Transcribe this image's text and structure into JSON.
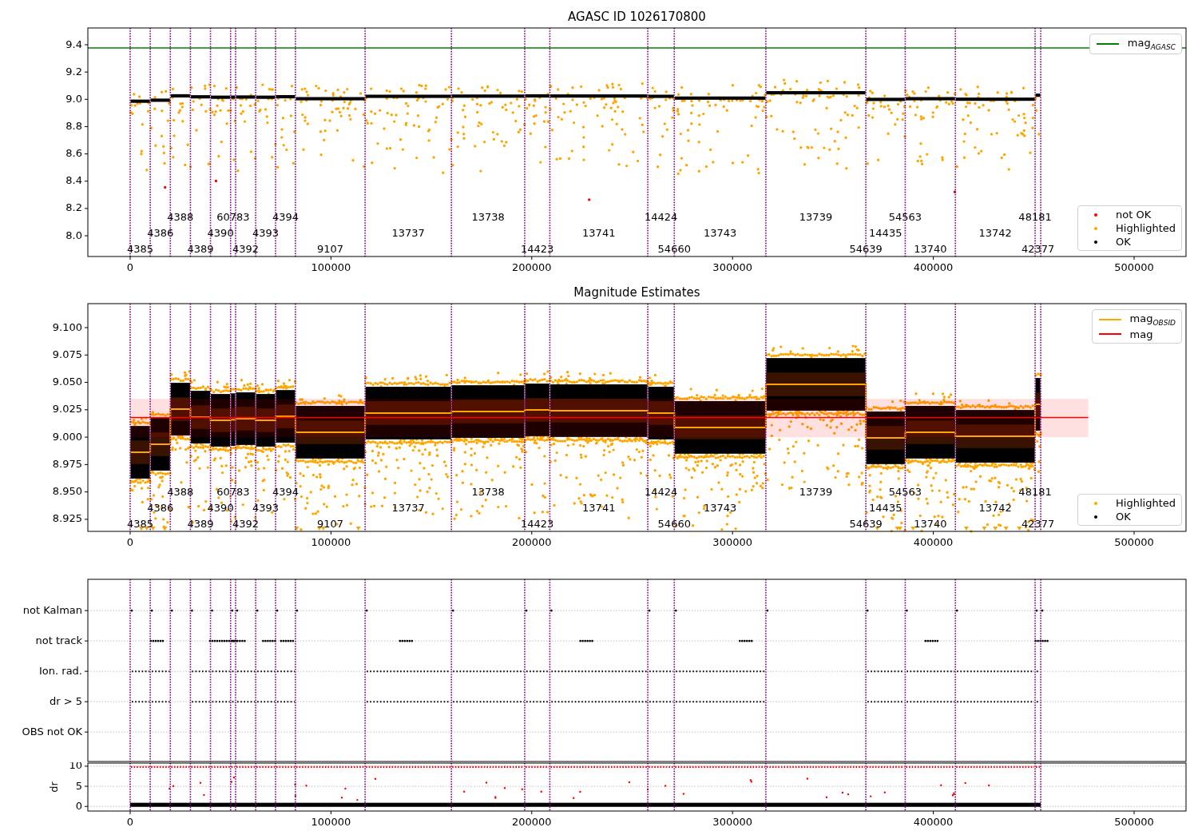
{
  "panels": [
    {
      "kind": "magnitude",
      "chart_data": {
        "type": "scatter",
        "title": "AGASC ID 1026170800",
        "xlim": [
          -21080,
          525860
        ],
        "ylim": [
          7.848,
          9.523
        ],
        "xticks": [
          0,
          100000,
          200000,
          300000,
          400000,
          500000
        ],
        "yticks": [
          {
            "value": 8.0,
            "label": "8.0"
          },
          {
            "value": 8.2,
            "label": "8.2"
          },
          {
            "value": 8.4,
            "label": "8.4"
          },
          {
            "value": 8.6,
            "label": "8.6"
          },
          {
            "value": 8.8,
            "label": "8.8"
          },
          {
            "value": 9.0,
            "label": "9.0"
          },
          {
            "value": 9.2,
            "label": "9.2"
          },
          {
            "value": 9.4,
            "label": "9.4"
          }
        ],
        "ref_lines": [
          {
            "axis": "y",
            "value": 9.377,
            "color": "#008000"
          },
          {
            "axis": "x",
            "value": 0,
            "color": "#800080"
          },
          {
            "axis": "x",
            "value": 10000,
            "color": "#800080"
          },
          {
            "axis": "x",
            "value": 20000,
            "color": "#800080"
          },
          {
            "axis": "x",
            "value": 30000,
            "color": "#800080"
          },
          {
            "axis": "x",
            "value": 40000,
            "color": "#800080"
          },
          {
            "axis": "x",
            "value": 50000,
            "color": "#800080"
          },
          {
            "axis": "x",
            "value": 52500,
            "color": "#800080"
          },
          {
            "axis": "x",
            "value": 62500,
            "color": "#800080"
          },
          {
            "axis": "x",
            "value": 72400,
            "color": "#800080"
          },
          {
            "axis": "x",
            "value": 82300,
            "color": "#800080"
          },
          {
            "axis": "x",
            "value": 117000,
            "color": "#800080"
          },
          {
            "axis": "x",
            "value": 160000,
            "color": "#800080"
          },
          {
            "axis": "x",
            "value": 196500,
            "color": "#800080"
          },
          {
            "axis": "x",
            "value": 209000,
            "color": "#800080"
          },
          {
            "axis": "x",
            "value": 257800,
            "color": "#800080"
          },
          {
            "axis": "x",
            "value": 271000,
            "color": "#800080"
          },
          {
            "axis": "x",
            "value": 316600,
            "color": "#800080"
          },
          {
            "axis": "x",
            "value": 366400,
            "color": "#800080"
          },
          {
            "axis": "x",
            "value": 386000,
            "color": "#800080"
          },
          {
            "axis": "x",
            "value": 411000,
            "color": "#800080"
          },
          {
            "axis": "x",
            "value": 450700,
            "color": "#800080"
          },
          {
            "axis": "x",
            "value": 453500,
            "color": "#800080"
          }
        ],
        "annotations": [
          "4385",
          "4386",
          "4388",
          "4389",
          "4390",
          "60783",
          "4392",
          "4393",
          "4394",
          "9107",
          "13737",
          "13738",
          "14423",
          "13741",
          "14424",
          "54660",
          "13743",
          "13739",
          "54639",
          "14435",
          "54563",
          "13740",
          "13742",
          "48181",
          "42377"
        ]
      },
      "legends": [
        {
          "entries": [
            {
              "kind": "line",
              "label": "mag$_{AGASC}$",
              "color": "#008000"
            }
          ]
        },
        {
          "entries": [
            {
              "kind": "dot",
              "label": "not OK",
              "color": "#ff0000"
            },
            {
              "kind": "dot",
              "label": "Highlighted",
              "color": "#ffa500"
            },
            {
              "kind": "dot",
              "label": "OK",
              "color": "#000000"
            }
          ]
        }
      ]
    },
    {
      "kind": "estimates",
      "chart_data": {
        "type": "line",
        "title": "Magnitude Estimates",
        "xlim": [
          -21080,
          525860
        ],
        "ylim": [
          8.914,
          9.1219
        ],
        "xticks": [
          0,
          100000,
          200000,
          300000,
          400000,
          500000
        ],
        "yticks": [
          {
            "value": 8.925,
            "label": "8.925"
          },
          {
            "value": 8.95,
            "label": "8.950"
          },
          {
            "value": 8.975,
            "label": "8.975"
          },
          {
            "value": 9.0,
            "label": "9.000"
          },
          {
            "value": 9.025,
            "label": "9.025"
          },
          {
            "value": 9.05,
            "label": "9.050"
          },
          {
            "value": 9.075,
            "label": "9.075"
          },
          {
            "value": 9.1,
            "label": "9.100"
          }
        ],
        "x": [
          0,
          10000,
          10000,
          20000,
          20000,
          30000,
          30000,
          40000,
          40000,
          50000,
          50000,
          52500,
          52500,
          62500,
          62500,
          72400,
          72400,
          82300,
          82300,
          117000,
          117000,
          160000,
          160000,
          196500,
          196500,
          209000,
          209000,
          257800,
          257800,
          271000,
          271000,
          316600,
          316600,
          366400,
          366400,
          386000,
          386000,
          411000,
          411000,
          450700,
          450700,
          453500
        ],
        "series": [
          {
            "name": "mag$_{OBSID}$",
            "color": "#ffa500",
            "values": [
              8.9862,
              8.9862,
              8.9935,
              8.9935,
              9.0256,
              9.0256,
              9.0183,
              9.0183,
              9.0154,
              9.0154,
              9.016,
              9.016,
              9.0169,
              9.0169,
              9.0154,
              9.0154,
              9.019,
              9.019,
              9.0045,
              9.0045,
              9.022,
              9.022,
              9.0234,
              9.0234,
              9.0249,
              9.0249,
              9.0242,
              9.0242,
              9.022,
              9.022,
              9.0089,
              9.0089,
              9.0482,
              9.0482,
              8.9994,
              8.9994,
              9.0045,
              9.0045,
              9.0008,
              9.0008,
              9.03,
              9.03
            ]
          }
        ],
        "ref_lines": [
          {
            "axis": "y",
            "value": 9.018,
            "color": "#ff0000"
          },
          {
            "axis": "x",
            "value": 0,
            "color": "#800080"
          },
          {
            "axis": "x",
            "value": 10000,
            "color": "#800080"
          },
          {
            "axis": "x",
            "value": 20000,
            "color": "#800080"
          },
          {
            "axis": "x",
            "value": 30000,
            "color": "#800080"
          },
          {
            "axis": "x",
            "value": 40000,
            "color": "#800080"
          },
          {
            "axis": "x",
            "value": 50000,
            "color": "#800080"
          },
          {
            "axis": "x",
            "value": 52500,
            "color": "#800080"
          },
          {
            "axis": "x",
            "value": 62500,
            "color": "#800080"
          },
          {
            "axis": "x",
            "value": 72400,
            "color": "#800080"
          },
          {
            "axis": "x",
            "value": 82300,
            "color": "#800080"
          },
          {
            "axis": "x",
            "value": 117000,
            "color": "#800080"
          },
          {
            "axis": "x",
            "value": 160000,
            "color": "#800080"
          },
          {
            "axis": "x",
            "value": 196500,
            "color": "#800080"
          },
          {
            "axis": "x",
            "value": 209000,
            "color": "#800080"
          },
          {
            "axis": "x",
            "value": 257800,
            "color": "#800080"
          },
          {
            "axis": "x",
            "value": 271000,
            "color": "#800080"
          },
          {
            "axis": "x",
            "value": 316600,
            "color": "#800080"
          },
          {
            "axis": "x",
            "value": 366400,
            "color": "#800080"
          },
          {
            "axis": "x",
            "value": 386000,
            "color": "#800080"
          },
          {
            "axis": "x",
            "value": 411000,
            "color": "#800080"
          },
          {
            "axis": "x",
            "value": 450700,
            "color": "#800080"
          },
          {
            "axis": "x",
            "value": 453500,
            "color": "#800080"
          }
        ],
        "bands": [
          {
            "axis": "y",
            "from": 9.0,
            "to": 9.035,
            "color": "#ff0000"
          }
        ],
        "annotations": [
          "4385",
          "4386",
          "4388",
          "4389",
          "4390",
          "60783",
          "4392",
          "4393",
          "4394",
          "9107",
          "13737",
          "13738",
          "14423",
          "13741",
          "14424",
          "54660",
          "13743",
          "13739",
          "54639",
          "14435",
          "54563",
          "13740",
          "13742",
          "48181",
          "42377"
        ]
      },
      "legends": [
        {
          "entries": [
            {
              "kind": "line",
              "label": "mag",
              "color": "#ff0000"
            }
          ]
        },
        {
          "entries": [
            {
              "kind": "dot",
              "label": "Highlighted",
              "color": "#ffa500"
            },
            {
              "kind": "dot",
              "label": "OK",
              "color": "#000000"
            }
          ]
        }
      ]
    },
    {
      "kind": "flags",
      "chart_data": {
        "type": "scatter",
        "orientation": "horizontal",
        "xlim": [
          -21080,
          525860
        ],
        "grid": true,
        "categories": [
          "not Kalman",
          "not track",
          "Ion. rad.",
          "dr > 5",
          "OBS not OK"
        ],
        "ref_lines": [
          {
            "axis": "x",
            "value": 0,
            "color": "#800080"
          },
          {
            "axis": "x",
            "value": 10000,
            "color": "#800080"
          },
          {
            "axis": "x",
            "value": 20000,
            "color": "#800080"
          },
          {
            "axis": "x",
            "value": 30000,
            "color": "#800080"
          },
          {
            "axis": "x",
            "value": 40000,
            "color": "#800080"
          },
          {
            "axis": "x",
            "value": 50000,
            "color": "#800080"
          },
          {
            "axis": "x",
            "value": 52500,
            "color": "#800080"
          },
          {
            "axis": "x",
            "value": 62500,
            "color": "#800080"
          },
          {
            "axis": "x",
            "value": 72400,
            "color": "#800080"
          },
          {
            "axis": "x",
            "value": 82300,
            "color": "#800080"
          },
          {
            "axis": "x",
            "value": 117000,
            "color": "#800080"
          },
          {
            "axis": "x",
            "value": 160000,
            "color": "#800080"
          },
          {
            "axis": "x",
            "value": 196500,
            "color": "#800080"
          },
          {
            "axis": "x",
            "value": 209000,
            "color": "#800080"
          },
          {
            "axis": "x",
            "value": 257800,
            "color": "#800080"
          },
          {
            "axis": "x",
            "value": 271000,
            "color": "#800080"
          },
          {
            "axis": "x",
            "value": 316600,
            "color": "#800080"
          },
          {
            "axis": "x",
            "value": 366400,
            "color": "#800080"
          },
          {
            "axis": "x",
            "value": 386000,
            "color": "#800080"
          },
          {
            "axis": "x",
            "value": 411000,
            "color": "#800080"
          },
          {
            "axis": "x",
            "value": 450700,
            "color": "#800080"
          },
          {
            "axis": "x",
            "value": 453500,
            "color": "#800080"
          }
        ]
      }
    },
    {
      "kind": "dr",
      "chart_data": {
        "type": "scatter",
        "xlim": [
          -21080,
          525860
        ],
        "ylim": [
          -1.15,
          10.77
        ],
        "ylabel": "dr",
        "grid": true,
        "xticks": [
          0,
          100000,
          200000,
          300000,
          400000,
          500000
        ],
        "yticks": [
          0,
          5,
          10
        ],
        "ref_lines": [
          {
            "axis": "x",
            "value": 0,
            "color": "#800080"
          },
          {
            "axis": "x",
            "value": 10000,
            "color": "#800080"
          },
          {
            "axis": "x",
            "value": 20000,
            "color": "#800080"
          },
          {
            "axis": "x",
            "value": 30000,
            "color": "#800080"
          },
          {
            "axis": "x",
            "value": 40000,
            "color": "#800080"
          },
          {
            "axis": "x",
            "value": 50000,
            "color": "#800080"
          },
          {
            "axis": "x",
            "value": 52500,
            "color": "#800080"
          },
          {
            "axis": "x",
            "value": 62500,
            "color": "#800080"
          },
          {
            "axis": "x",
            "value": 72400,
            "color": "#800080"
          },
          {
            "axis": "x",
            "value": 82300,
            "color": "#800080"
          },
          {
            "axis": "x",
            "value": 117000,
            "color": "#800080"
          },
          {
            "axis": "x",
            "value": 160000,
            "color": "#800080"
          },
          {
            "axis": "x",
            "value": 196500,
            "color": "#800080"
          },
          {
            "axis": "x",
            "value": 209000,
            "color": "#800080"
          },
          {
            "axis": "x",
            "value": 257800,
            "color": "#800080"
          },
          {
            "axis": "x",
            "value": 271000,
            "color": "#800080"
          },
          {
            "axis": "x",
            "value": 316600,
            "color": "#800080"
          },
          {
            "axis": "x",
            "value": 366400,
            "color": "#800080"
          },
          {
            "axis": "x",
            "value": 386000,
            "color": "#800080"
          },
          {
            "axis": "x",
            "value": 411000,
            "color": "#800080"
          },
          {
            "axis": "x",
            "value": 450700,
            "color": "#800080"
          },
          {
            "axis": "x",
            "value": 453500,
            "color": "#800080"
          }
        ]
      }
    }
  ]
}
